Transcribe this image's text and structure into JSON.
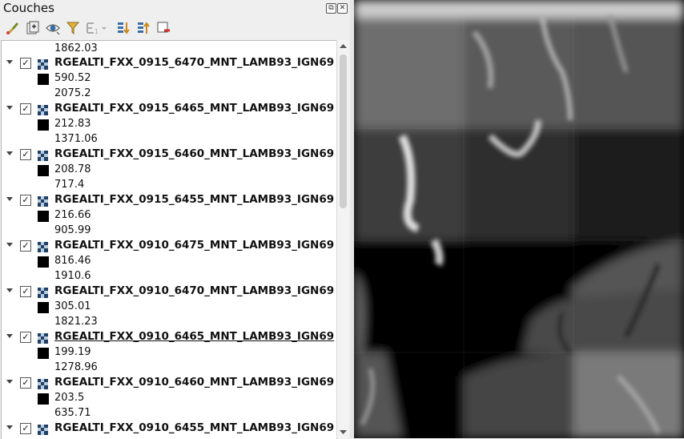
{
  "panel": {
    "title": "Couches",
    "float_label": "⧉",
    "close_label": "✕"
  },
  "toolbar": {
    "icons": [
      "style-manager-icon",
      "add-group-icon",
      "visibility-icon",
      "filter-icon",
      "filter-expression-icon",
      "expand-all-icon",
      "collapse-all-icon",
      "remove-layer-icon"
    ]
  },
  "tree": {
    "top_value": "1862.03",
    "layers": [
      {
        "name": "RGEALTI_FXX_0915_6470_MNT_LAMB93_IGN69",
        "min": "590.52",
        "max": "2075.2",
        "checked": true,
        "selected": false
      },
      {
        "name": "RGEALTI_FXX_0915_6465_MNT_LAMB93_IGN69",
        "min": "212.83",
        "max": "1371.06",
        "checked": true,
        "selected": false
      },
      {
        "name": "RGEALTI_FXX_0915_6460_MNT_LAMB93_IGN69",
        "min": "208.78",
        "max": "717.4",
        "checked": true,
        "selected": false
      },
      {
        "name": "RGEALTI_FXX_0915_6455_MNT_LAMB93_IGN69",
        "min": "216.66",
        "max": "905.99",
        "checked": true,
        "selected": false
      },
      {
        "name": "RGEALTI_FXX_0910_6475_MNT_LAMB93_IGN69",
        "min": "816.46",
        "max": "1910.6",
        "checked": true,
        "selected": false
      },
      {
        "name": "RGEALTI_FXX_0910_6470_MNT_LAMB93_IGN69",
        "min": "305.01",
        "max": "1821.23",
        "checked": true,
        "selected": false
      },
      {
        "name": "RGEALTI_FXX_0910_6465_MNT_LAMB93_IGN69",
        "min": "199.19",
        "max": "1278.96",
        "checked": true,
        "selected": true
      },
      {
        "name": "RGEALTI_FXX_0910_6460_MNT_LAMB93_IGN69",
        "min": "203.5",
        "max": "635.71",
        "checked": true,
        "selected": false
      },
      {
        "name": "RGEALTI_FXX_0910_6455_MNT_LAMB93_IGN69",
        "min": "",
        "max": "",
        "checked": true,
        "selected": false
      }
    ],
    "checkmark": "✓"
  }
}
